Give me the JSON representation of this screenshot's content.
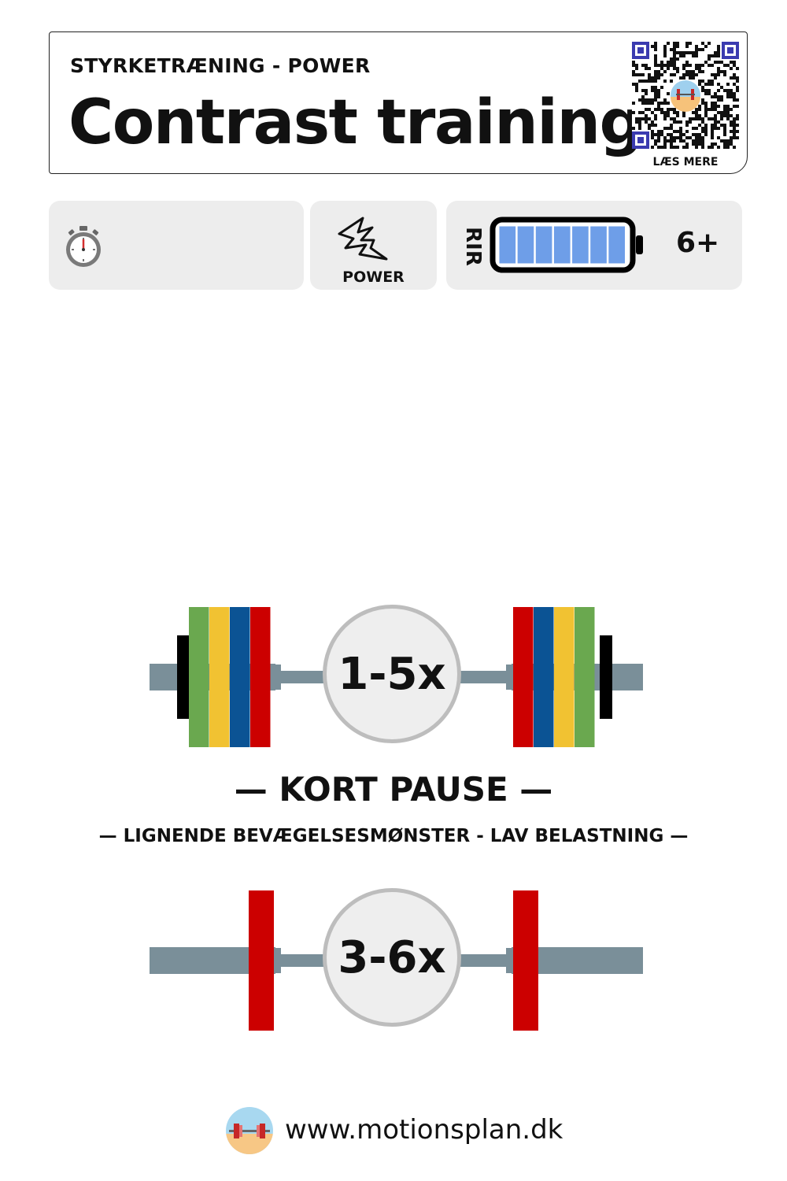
{
  "header": {
    "category": "STYRKETRÆNING - POWER",
    "title": "Contrast training",
    "qr_label": "LÆS MERE"
  },
  "stats": {
    "timer_icon": "stopwatch-icon",
    "type_icon": "lightning-icon",
    "type_label": "POWER",
    "rir_label": "RIR",
    "rir_value": "6+",
    "battery_level": 1.0,
    "battery_color": "#6e9ee8"
  },
  "sets": [
    {
      "reps": "1-5x",
      "plates": [
        "#6aa84f",
        "#f1c232",
        "#0b5394",
        "#cc0000"
      ]
    },
    {
      "reps": "3-6x",
      "plates": [
        "#cc0000"
      ]
    }
  ],
  "pause": {
    "label": "— KORT PAUSE —",
    "instruction": "— LIGNENDE BEVÆGELSESMØNSTER - LAV BELASTNING —"
  },
  "footer": {
    "url": "www.motionsplan.dk",
    "logo_icon": "barbell-logo-icon"
  },
  "colors": {
    "bar": "#7a8f99",
    "collar": "#000000",
    "circle_fill": "#eeeeee",
    "circle_border": "#bdbdbd"
  }
}
